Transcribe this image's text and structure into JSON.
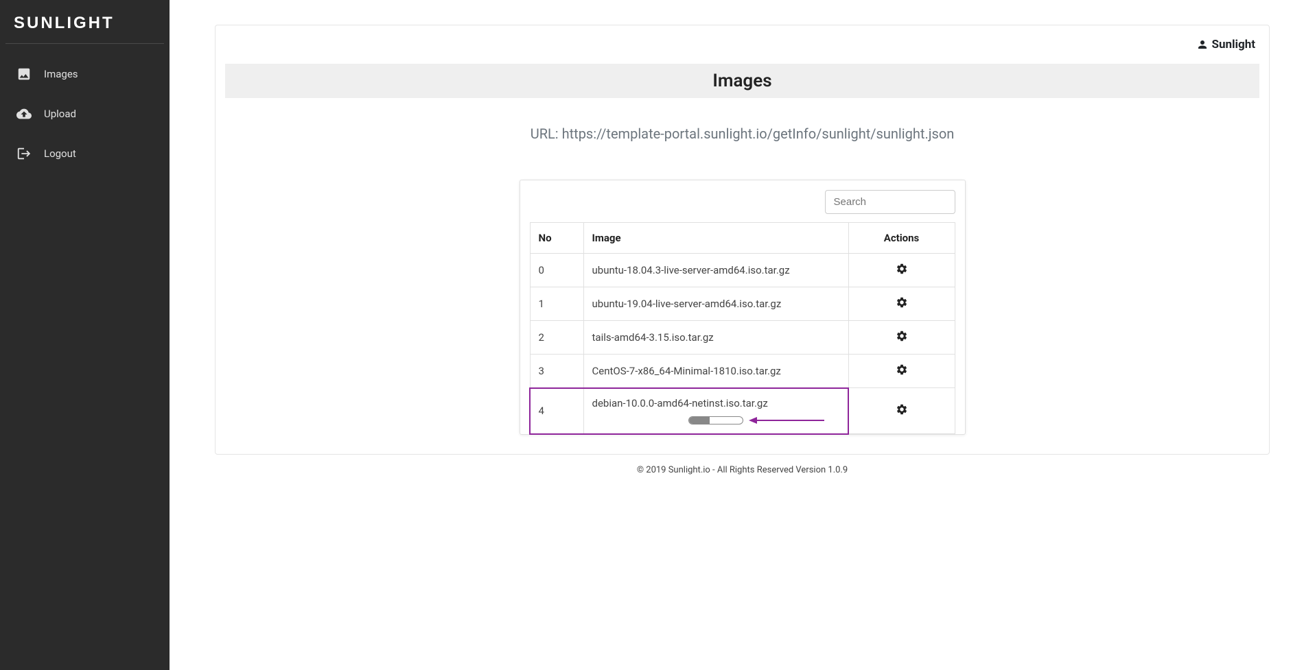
{
  "brand": "SUNLIGHT",
  "sidebar": {
    "items": [
      {
        "label": "Images",
        "icon": "image"
      },
      {
        "label": "Upload",
        "icon": "cloud-upload"
      },
      {
        "label": "Logout",
        "icon": "logout"
      }
    ]
  },
  "header": {
    "username": "Sunlight"
  },
  "page": {
    "title": "Images",
    "url_label": "URL: https://template-portal.sunlight.io/getInfo/sunlight/sunlight.json"
  },
  "search": {
    "placeholder": "Search",
    "value": ""
  },
  "table": {
    "columns": {
      "no": "No",
      "image": "Image",
      "actions": "Actions"
    },
    "rows": [
      {
        "no": "0",
        "image": "ubuntu-18.04.3-live-server-amd64.iso.tar.gz"
      },
      {
        "no": "1",
        "image": "ubuntu-19.04-live-server-amd64.iso.tar.gz"
      },
      {
        "no": "2",
        "image": "tails-amd64-3.15.iso.tar.gz"
      },
      {
        "no": "3",
        "image": "CentOS-7-x86_64-Minimal-1810.iso.tar.gz"
      },
      {
        "no": "4",
        "image": "debian-10.0.0-amd64-netinst.iso.tar.gz"
      }
    ]
  },
  "footer": {
    "text": "© 2019 Sunlight.io - All Rights Reserved Version 1.0.9"
  },
  "annotation": {
    "highlight_row_index": 4,
    "arrow_color": "#8e259a"
  }
}
